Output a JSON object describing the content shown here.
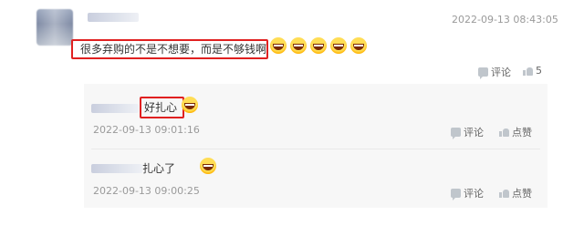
{
  "comment": {
    "time": "2022-09-13 08:43:05",
    "text": "很多弃购的不是不想要，而是不够钱啊",
    "emoji_count": 5,
    "actions": {
      "reply_label": "评论",
      "like_count": "5"
    }
  },
  "replies": [
    {
      "text": "好扎心",
      "time": "2022-09-13 09:01:16",
      "actions": {
        "reply_label": "评论",
        "like_label": "点赞"
      }
    },
    {
      "text": "扎心了",
      "time": "2022-09-13 09:00:25",
      "actions": {
        "reply_label": "评论",
        "like_label": "点赞"
      }
    }
  ],
  "colors": {
    "highlight": "#e02020",
    "reply_bg": "#f7f7f7",
    "muted": "#9a9a9a"
  },
  "icons": [
    "laughing-emoji-icon",
    "comment-icon",
    "thumbs-up-icon"
  ]
}
